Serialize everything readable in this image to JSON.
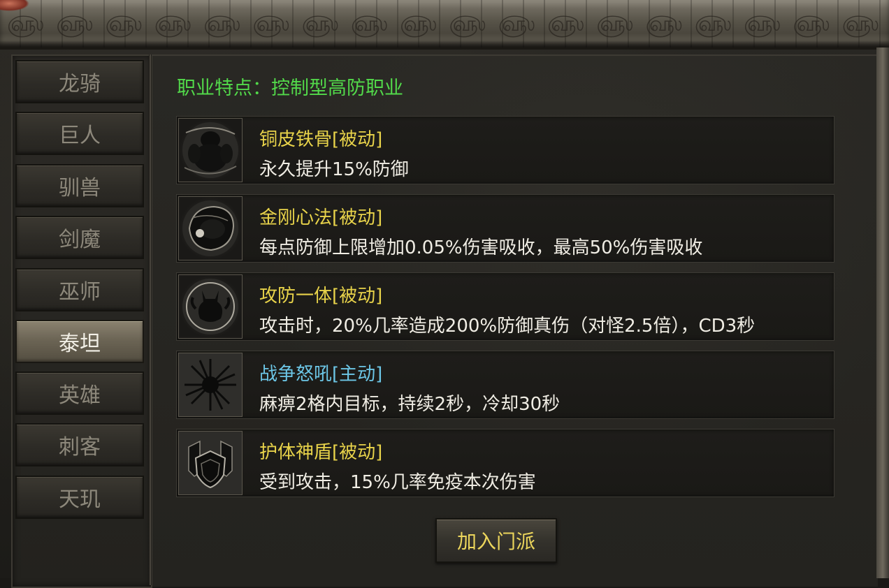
{
  "class_list": [
    {
      "label": "龙骑",
      "active": false
    },
    {
      "label": "巨人",
      "active": false
    },
    {
      "label": "驯兽",
      "active": false
    },
    {
      "label": "剑魔",
      "active": false
    },
    {
      "label": "巫师",
      "active": false
    },
    {
      "label": "泰坦",
      "active": true
    },
    {
      "label": "英雄",
      "active": false
    },
    {
      "label": "刺客",
      "active": false
    },
    {
      "label": "天玑",
      "active": false
    }
  ],
  "main": {
    "feature_text": "职业特点：控制型高防职业",
    "skills": [
      {
        "name": "铜皮铁骨[被动]",
        "type": "passive",
        "desc": "永久提升15%防御",
        "icon": "stone-golem-icon"
      },
      {
        "name": "金刚心法[被动]",
        "type": "passive",
        "desc": "每点防御上限增加0.05%伤害吸收，最高50%伤害吸收",
        "icon": "swirl-orb-icon"
      },
      {
        "name": "攻防一体[被动]",
        "type": "passive",
        "desc": "攻击时，20%几率造成200%防御真伤（对怪2.5倍），CD3秒",
        "icon": "demon-circle-icon"
      },
      {
        "name": "战争怒吼[主动]",
        "type": "active",
        "desc": "麻痹2格内目标，持续2秒，冷却30秒",
        "icon": "burst-icon"
      },
      {
        "name": "护体神盾[被动]",
        "type": "passive",
        "desc": "受到攻击，15%几率免疫本次伤害",
        "icon": "shield-icon"
      }
    ],
    "join_button": "加入门派"
  },
  "colors": {
    "feature_green": "#52d94a",
    "skill_passive_yellow": "#e8d34a",
    "skill_active_blue": "#6cc6e6",
    "desc_white": "#f0ede4"
  }
}
